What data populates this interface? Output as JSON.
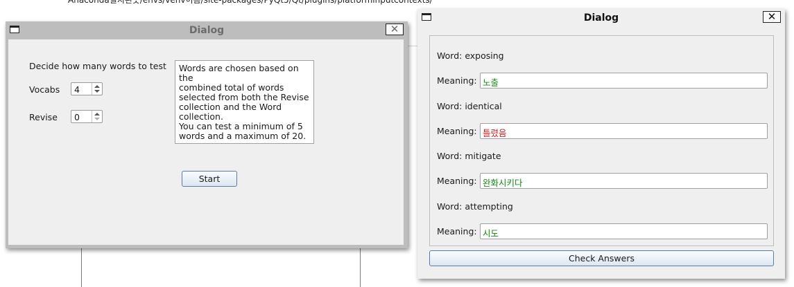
{
  "background": {
    "path_text": "Anaconda설치된곳/envs/venv이름/site-packages/PyQt5/Qt/plugins/platforminputcontexts/"
  },
  "left_dialog": {
    "title": "Dialog",
    "close_glyph": "✕",
    "instruction": "Decide how many words to test",
    "vocabs_label": "Vocabs",
    "vocabs_value": "4",
    "revise_label": "Revise",
    "revise_value": "0",
    "info_text": "Words are chosen based on the\ncombined total of words\nselected from both the Revise\ncollection and the Word\ncollection.\nYou can test a minimum of 5\nwords and a maximum of 20.",
    "start_label": "Start"
  },
  "right_dialog": {
    "title": "Dialog",
    "close_glyph": "✕",
    "meaning_label": "Meaning:",
    "items": [
      {
        "word": "Word: exposing",
        "meaning": "노출",
        "status": "correct"
      },
      {
        "word": "Word: identical",
        "meaning": "틀렸음",
        "status": "wrong"
      },
      {
        "word": "Word: mitigate",
        "meaning": "완화시키다",
        "status": "correct"
      },
      {
        "word": "Word: attempting",
        "meaning": "시도",
        "status": "correct"
      }
    ],
    "check_label": "Check Answers"
  },
  "colors": {
    "correct": "#108a10",
    "wrong": "#d42020",
    "inactive_title": "#6c6c6c",
    "button_border": "#5b7aa5"
  },
  "icons": [
    "window-icon",
    "close-icon",
    "spin-up-icon",
    "spin-down-icon"
  ]
}
